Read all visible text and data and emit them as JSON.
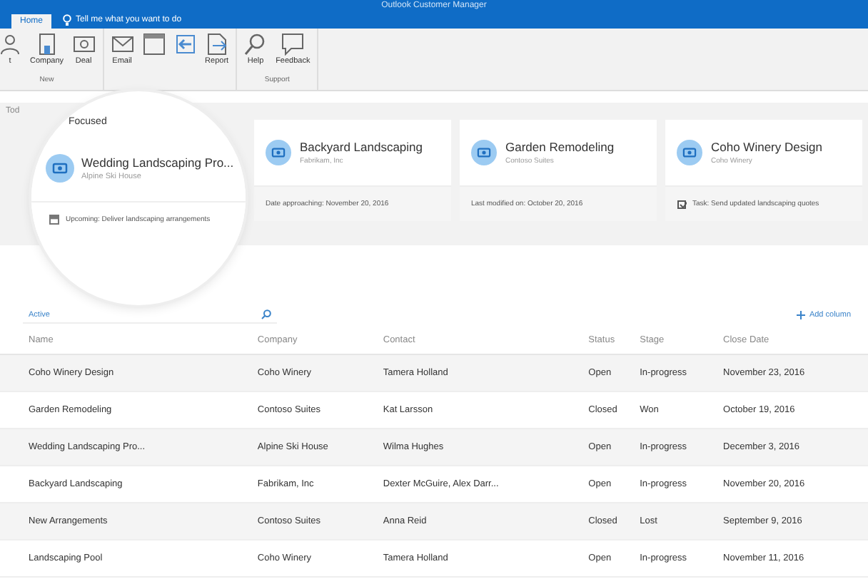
{
  "window": {
    "title": "Outlook Customer Manager"
  },
  "tabs": [
    {
      "label": "Home",
      "selected": true
    }
  ],
  "tell_me": {
    "placeholder": "Tell me what you want to do"
  },
  "ribbon": [
    {
      "label": "New",
      "buttons": [
        {
          "label": "t",
          "kind": "contact"
        },
        {
          "label": "Company",
          "kind": "company"
        },
        {
          "label": "Deal",
          "kind": "deal"
        }
      ]
    },
    {
      "buttons": [
        {
          "label": "Email",
          "kind": "email"
        },
        {
          "kind": "calendar"
        },
        {
          "kind": "import"
        },
        {
          "label": "Report",
          "kind": "report"
        }
      ]
    },
    {
      "label": "Support",
      "buttons": [
        {
          "label": "Help",
          "kind": "help"
        },
        {
          "label": "Feedback",
          "kind": "feedback"
        }
      ]
    }
  ],
  "section_heading": "Tod",
  "lens": {
    "tab": "Focused",
    "card": {
      "name": "Wedding Landscaping Pro...",
      "company": "Alpine Ski House",
      "note": "Upcoming: Deliver landscaping arrangements",
      "kind": "calendar"
    }
  },
  "cards": [
    {
      "name": "Backyard Landscaping",
      "company": "Fabrikam, Inc",
      "note": "Date approaching: November 20, 2016",
      "kind": "plain"
    },
    {
      "name": "Garden Remodeling",
      "company": "Contoso Suites",
      "note": "Last modified on: October 20, 2016",
      "kind": "plain"
    },
    {
      "name": "Coho Winery Design",
      "company": "Coho Winery",
      "note": "Task: Send updated landscaping quotes",
      "kind": "task"
    }
  ],
  "filter": {
    "value": "Active"
  },
  "add_column": "Add column",
  "table": {
    "columns": [
      "Name",
      "Company",
      "Contact",
      "Status",
      "Stage",
      "Close Date"
    ],
    "rows": [
      [
        "Coho Winery Design",
        "Coho Winery",
        "Tamera Holland",
        "Open",
        "In-progress",
        "November 23, 2016"
      ],
      [
        "Garden Remodeling",
        "Contoso Suites",
        "Kat Larsson",
        "Closed",
        "Won",
        "October 19, 2016"
      ],
      [
        "Wedding Landscaping Pro...",
        "Alpine Ski House",
        "Wilma Hughes",
        "Open",
        "In-progress",
        "December 3, 2016"
      ],
      [
        "Backyard Landscaping",
        "Fabrikam, Inc",
        "Dexter McGuire, Alex Darr...",
        "Open",
        "In-progress",
        "November 20, 2016"
      ],
      [
        "New Arrangements",
        "Contoso Suites",
        "Anna Reid",
        "Closed",
        "Lost",
        "September 9, 2016"
      ],
      [
        "Landscaping Pool",
        "Coho Winery",
        "Tamera Holland",
        "Open",
        "In-progress",
        "November 11, 2016"
      ]
    ]
  }
}
